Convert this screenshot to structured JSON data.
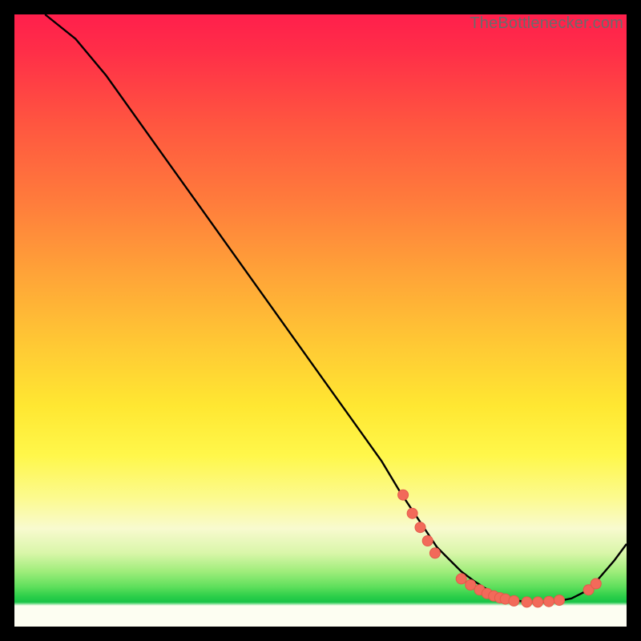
{
  "attribution": "TheBottlenecker.com",
  "colors": {
    "frame": "#000000",
    "curve_stroke": "#000000",
    "marker_fill": "#f26a5a",
    "marker_stroke": "#e45a4a"
  },
  "chart_data": {
    "type": "line",
    "title": "",
    "xlabel": "",
    "ylabel": "",
    "xlim": [
      0,
      100
    ],
    "ylim": [
      0,
      100
    ],
    "grid": false,
    "legend": false,
    "series": [
      {
        "name": "bottleneck-curve",
        "x": [
          5,
          10,
          15,
          20,
          25,
          30,
          35,
          40,
          45,
          50,
          55,
          60,
          63,
          65,
          67,
          69,
          71,
          73,
          75,
          77,
          79,
          81,
          83,
          85,
          87,
          89,
          91,
          93,
          95,
          98,
          100
        ],
        "y": [
          100,
          96,
          90,
          83,
          76,
          69,
          62,
          55,
          48,
          41,
          34,
          27,
          22,
          19,
          16,
          13,
          11,
          9,
          7.5,
          6.2,
          5.2,
          4.5,
          4.1,
          4.0,
          4.0,
          4.2,
          4.6,
          5.6,
          7.3,
          10.8,
          13.5
        ]
      }
    ],
    "markers": [
      {
        "x": 63.5,
        "y": 21.5
      },
      {
        "x": 65.0,
        "y": 18.5
      },
      {
        "x": 66.3,
        "y": 16.2
      },
      {
        "x": 67.5,
        "y": 14.0
      },
      {
        "x": 68.7,
        "y": 12.0
      },
      {
        "x": 73.0,
        "y": 7.8
      },
      {
        "x": 74.5,
        "y": 6.8
      },
      {
        "x": 76.0,
        "y": 6.0
      },
      {
        "x": 77.2,
        "y": 5.4
      },
      {
        "x": 78.3,
        "y": 5.0
      },
      {
        "x": 79.3,
        "y": 4.7
      },
      {
        "x": 80.2,
        "y": 4.5
      },
      {
        "x": 81.6,
        "y": 4.2
      },
      {
        "x": 83.7,
        "y": 4.0
      },
      {
        "x": 85.5,
        "y": 4.0
      },
      {
        "x": 87.3,
        "y": 4.1
      },
      {
        "x": 89.0,
        "y": 4.3
      },
      {
        "x": 93.8,
        "y": 6.0
      },
      {
        "x": 95.0,
        "y": 7.0
      }
    ]
  }
}
